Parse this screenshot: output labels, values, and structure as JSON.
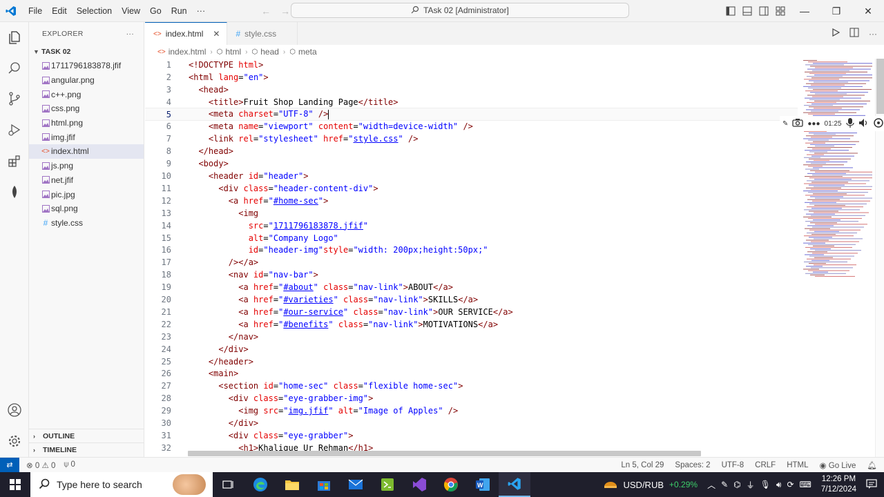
{
  "window": {
    "title": "TAsk 02 [Administrator]",
    "menu": [
      "File",
      "Edit",
      "Selection",
      "View",
      "Go",
      "Run",
      "···"
    ]
  },
  "explorer": {
    "header": "EXPLORER",
    "more": "···",
    "folder": "TASK 02",
    "files": [
      {
        "name": "1711796183878.jfif",
        "icon": "image-icon",
        "color": "#a074c4"
      },
      {
        "name": "angular.png",
        "icon": "image-icon",
        "color": "#a074c4"
      },
      {
        "name": "c++.png",
        "icon": "image-icon",
        "color": "#a074c4"
      },
      {
        "name": "css.png",
        "icon": "image-icon",
        "color": "#a074c4"
      },
      {
        "name": "html.png",
        "icon": "image-icon",
        "color": "#a074c4"
      },
      {
        "name": "img.jfif",
        "icon": "image-icon",
        "color": "#a074c4"
      },
      {
        "name": "index.html",
        "icon": "html-file-icon",
        "color": "#e44d26"
      },
      {
        "name": "js.png",
        "icon": "image-icon",
        "color": "#a074c4"
      },
      {
        "name": "net.jfif",
        "icon": "image-icon",
        "color": "#a074c4"
      },
      {
        "name": "pic.jpg",
        "icon": "image-icon",
        "color": "#a074c4"
      },
      {
        "name": "sql.png",
        "icon": "image-icon",
        "color": "#a074c4"
      },
      {
        "name": "style.css",
        "icon": "css-file-icon",
        "color": "#42a5f5"
      }
    ],
    "active_file": "index.html",
    "outline": "OUTLINE",
    "timeline": "TIMELINE"
  },
  "tabs": [
    {
      "label": "index.html",
      "active": true
    },
    {
      "label": "style.css",
      "active": false
    }
  ],
  "breadcrumb": [
    "index.html",
    "html",
    "head",
    "meta"
  ],
  "editor": {
    "current_line": 5,
    "lines": [
      [
        [
          "tg",
          "<!DOCTYPE "
        ],
        [
          "at",
          "html"
        ],
        [
          "tg",
          ">"
        ]
      ],
      [
        [
          "tg",
          "<html "
        ],
        [
          "at",
          "lang"
        ],
        [
          "tx",
          "="
        ],
        [
          "st",
          "\"en\""
        ],
        [
          "tg",
          ">"
        ]
      ],
      [
        [
          "tx",
          "  "
        ],
        [
          "tg",
          "<head>"
        ]
      ],
      [
        [
          "tx",
          "    "
        ],
        [
          "tg",
          "<title>"
        ],
        [
          "tx",
          "Fruit Shop Landing Page"
        ],
        [
          "tg",
          "</title>"
        ]
      ],
      [
        [
          "tx",
          "    "
        ],
        [
          "tg",
          "<meta "
        ],
        [
          "at",
          "charset"
        ],
        [
          "tx",
          "="
        ],
        [
          "st",
          "\"UTF-8\""
        ],
        [
          "tx",
          " "
        ],
        [
          "tg",
          "/>"
        ]
      ],
      [
        [
          "tx",
          "    "
        ],
        [
          "tg",
          "<meta "
        ],
        [
          "at",
          "name"
        ],
        [
          "tx",
          "="
        ],
        [
          "st",
          "\"viewport\""
        ],
        [
          "tx",
          " "
        ],
        [
          "at",
          "content"
        ],
        [
          "tx",
          "="
        ],
        [
          "st",
          "\"width=device-width\""
        ],
        [
          "tx",
          " "
        ],
        [
          "tg",
          "/>"
        ]
      ],
      [
        [
          "tx",
          "    "
        ],
        [
          "tg",
          "<link "
        ],
        [
          "at",
          "rel"
        ],
        [
          "tx",
          "="
        ],
        [
          "st",
          "\"stylesheet\""
        ],
        [
          "tx",
          " "
        ],
        [
          "at",
          "href"
        ],
        [
          "tx",
          "="
        ],
        [
          "st",
          "\""
        ],
        [
          "stu",
          "style.css"
        ],
        [
          "st",
          "\""
        ],
        [
          "tx",
          " "
        ],
        [
          "tg",
          "/>"
        ]
      ],
      [
        [
          "tx",
          "  "
        ],
        [
          "tg",
          "</head>"
        ]
      ],
      [
        [
          "tx",
          "  "
        ],
        [
          "tg",
          "<body>"
        ]
      ],
      [
        [
          "tx",
          "    "
        ],
        [
          "tg",
          "<header "
        ],
        [
          "at",
          "id"
        ],
        [
          "tx",
          "="
        ],
        [
          "st",
          "\"header\""
        ],
        [
          "tg",
          ">"
        ]
      ],
      [
        [
          "tx",
          "      "
        ],
        [
          "tg",
          "<div "
        ],
        [
          "at",
          "class"
        ],
        [
          "tx",
          "="
        ],
        [
          "st",
          "\"header-content-div\""
        ],
        [
          "tg",
          ">"
        ]
      ],
      [
        [
          "tx",
          "        "
        ],
        [
          "tg",
          "<a "
        ],
        [
          "at",
          "href"
        ],
        [
          "tx",
          "="
        ],
        [
          "st",
          "\""
        ],
        [
          "stu",
          "#home-sec"
        ],
        [
          "st",
          "\""
        ],
        [
          "tg",
          ">"
        ]
      ],
      [
        [
          "tx",
          "          "
        ],
        [
          "tg",
          "<img"
        ]
      ],
      [
        [
          "tx",
          "            "
        ],
        [
          "at",
          "src"
        ],
        [
          "tx",
          "="
        ],
        [
          "st",
          "\""
        ],
        [
          "stu",
          "1711796183878.jfif"
        ],
        [
          "st",
          "\""
        ]
      ],
      [
        [
          "tx",
          "            "
        ],
        [
          "at",
          "alt"
        ],
        [
          "tx",
          "="
        ],
        [
          "st",
          "\"Company Logo\""
        ]
      ],
      [
        [
          "tx",
          "            "
        ],
        [
          "at",
          "id"
        ],
        [
          "tx",
          "="
        ],
        [
          "st",
          "\"header-img\""
        ],
        [
          "at",
          "style"
        ],
        [
          "tx",
          "="
        ],
        [
          "st",
          "\"width: 200px;height:50px;\""
        ]
      ],
      [
        [
          "tx",
          "        "
        ],
        [
          "tg",
          "/></a>"
        ]
      ],
      [
        [
          "tx",
          "        "
        ],
        [
          "tg",
          "<nav "
        ],
        [
          "at",
          "id"
        ],
        [
          "tx",
          "="
        ],
        [
          "st",
          "\"nav-bar\""
        ],
        [
          "tg",
          ">"
        ]
      ],
      [
        [
          "tx",
          "          "
        ],
        [
          "tg",
          "<a "
        ],
        [
          "at",
          "href"
        ],
        [
          "tx",
          "="
        ],
        [
          "st",
          "\""
        ],
        [
          "stu",
          "#about"
        ],
        [
          "st",
          "\""
        ],
        [
          "tx",
          " "
        ],
        [
          "at",
          "class"
        ],
        [
          "tx",
          "="
        ],
        [
          "st",
          "\"nav-link\""
        ],
        [
          "tg",
          ">"
        ],
        [
          "tx",
          "ABOUT"
        ],
        [
          "tg",
          "</a>"
        ]
      ],
      [
        [
          "tx",
          "          "
        ],
        [
          "tg",
          "<a "
        ],
        [
          "at",
          "href"
        ],
        [
          "tx",
          "="
        ],
        [
          "st",
          "\""
        ],
        [
          "stu",
          "#varieties"
        ],
        [
          "st",
          "\""
        ],
        [
          "tx",
          " "
        ],
        [
          "at",
          "class"
        ],
        [
          "tx",
          "="
        ],
        [
          "st",
          "\"nav-link\""
        ],
        [
          "tg",
          ">"
        ],
        [
          "tx",
          "SKILLS"
        ],
        [
          "tg",
          "</a>"
        ]
      ],
      [
        [
          "tx",
          "          "
        ],
        [
          "tg",
          "<a "
        ],
        [
          "at",
          "href"
        ],
        [
          "tx",
          "="
        ],
        [
          "st",
          "\""
        ],
        [
          "stu",
          "#our-service"
        ],
        [
          "st",
          "\""
        ],
        [
          "tx",
          " "
        ],
        [
          "at",
          "class"
        ],
        [
          "tx",
          "="
        ],
        [
          "st",
          "\"nav-link\""
        ],
        [
          "tg",
          ">"
        ],
        [
          "tx",
          "OUR SERVICE"
        ],
        [
          "tg",
          "</a>"
        ]
      ],
      [
        [
          "tx",
          "          "
        ],
        [
          "tg",
          "<a "
        ],
        [
          "at",
          "href"
        ],
        [
          "tx",
          "="
        ],
        [
          "st",
          "\""
        ],
        [
          "stu",
          "#benefits"
        ],
        [
          "st",
          "\""
        ],
        [
          "tx",
          " "
        ],
        [
          "at",
          "class"
        ],
        [
          "tx",
          "="
        ],
        [
          "st",
          "\"nav-link\""
        ],
        [
          "tg",
          ">"
        ],
        [
          "tx",
          "MOTIVATIONS"
        ],
        [
          "tg",
          "</a>"
        ]
      ],
      [
        [
          "tx",
          "        "
        ],
        [
          "tg",
          "</nav>"
        ]
      ],
      [
        [
          "tx",
          "      "
        ],
        [
          "tg",
          "</div>"
        ]
      ],
      [
        [
          "tx",
          "    "
        ],
        [
          "tg",
          "</header>"
        ]
      ],
      [
        [
          "tx",
          "    "
        ],
        [
          "tg",
          "<main>"
        ]
      ],
      [
        [
          "tx",
          "      "
        ],
        [
          "tg",
          "<section "
        ],
        [
          "at",
          "id"
        ],
        [
          "tx",
          "="
        ],
        [
          "st",
          "\"home-sec\""
        ],
        [
          "tx",
          " "
        ],
        [
          "at",
          "class"
        ],
        [
          "tx",
          "="
        ],
        [
          "st",
          "\"flexible home-sec\""
        ],
        [
          "tg",
          ">"
        ]
      ],
      [
        [
          "tx",
          "        "
        ],
        [
          "tg",
          "<div "
        ],
        [
          "at",
          "class"
        ],
        [
          "tx",
          "="
        ],
        [
          "st",
          "\"eye-grabber-img\""
        ],
        [
          "tg",
          ">"
        ]
      ],
      [
        [
          "tx",
          "          "
        ],
        [
          "tg",
          "<img "
        ],
        [
          "at",
          "src"
        ],
        [
          "tx",
          "="
        ],
        [
          "st",
          "\""
        ],
        [
          "stu",
          "img.jfif"
        ],
        [
          "st",
          "\""
        ],
        [
          "tx",
          " "
        ],
        [
          "at",
          "alt"
        ],
        [
          "tx",
          "="
        ],
        [
          "st",
          "\"Image of Apples\""
        ],
        [
          "tx",
          " "
        ],
        [
          "tg",
          "/>"
        ]
      ],
      [
        [
          "tx",
          "        "
        ],
        [
          "tg",
          "</div>"
        ]
      ],
      [
        [
          "tx",
          "        "
        ],
        [
          "tg",
          "<div "
        ],
        [
          "at",
          "class"
        ],
        [
          "tx",
          "="
        ],
        [
          "st",
          "\"eye-grabber\""
        ],
        [
          "tg",
          ">"
        ]
      ],
      [
        [
          "tx",
          "          "
        ],
        [
          "tg",
          "<h1>"
        ],
        [
          "tx",
          "Khalique Ur Rehman"
        ],
        [
          "tg",
          "</h1>"
        ]
      ]
    ]
  },
  "recording": {
    "time": "01:25"
  },
  "statusbar": {
    "errors": "0",
    "warnings": "0",
    "ports": "0",
    "position": "Ln 5, Col 29",
    "spaces": "Spaces: 2",
    "encoding": "UTF-8",
    "eol": "CRLF",
    "language": "HTML",
    "golive": "Go Live"
  },
  "taskbar": {
    "search_placeholder": "Type here to search",
    "ticker": "USD/RUB",
    "ticker_change": "+0.29%",
    "time": "12:26 PM",
    "date": "7/12/2024",
    "colors": {
      "positive": "#3ccf6a",
      "taskbar": "#1f1f2c"
    }
  },
  "colors": {
    "accent": "#005fb8",
    "tag": "#800000",
    "attr": "#e50000",
    "string": "#0000ff"
  }
}
